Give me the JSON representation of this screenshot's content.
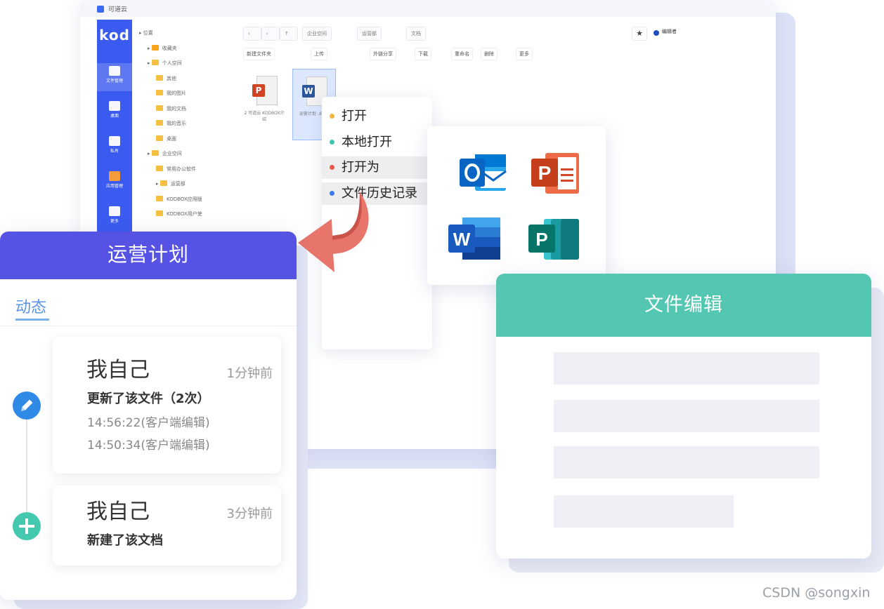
{
  "window": {
    "app_name": "可道云",
    "logo": "kod",
    "side_items": [
      "文件管理",
      "桌面",
      "私有",
      "应用管理",
      "更多"
    ],
    "tree": [
      {
        "label": "位置",
        "icon": "none",
        "indent": 0
      },
      {
        "label": "收藏夹",
        "icon": "star",
        "indent": 1
      },
      {
        "label": "个人空间",
        "icon": "folder",
        "indent": 1
      },
      {
        "label": "其他",
        "icon": "folder",
        "indent": 2
      },
      {
        "label": "我的图片",
        "icon": "folder",
        "indent": 2
      },
      {
        "label": "我的文档",
        "icon": "folder",
        "indent": 2
      },
      {
        "label": "我的音乐",
        "icon": "folder",
        "indent": 2
      },
      {
        "label": "桌面",
        "icon": "folder",
        "indent": 2
      },
      {
        "label": "企业空间",
        "icon": "folder",
        "indent": 1
      },
      {
        "label": "常用办公软件",
        "icon": "folder",
        "indent": 2
      },
      {
        "label": "运营部",
        "icon": "folder",
        "indent": 2
      },
      {
        "label": "KODBOX应用版",
        "icon": "folder",
        "indent": 2
      },
      {
        "label": "KODBOX用户使",
        "icon": "folder",
        "indent": 2
      }
    ],
    "breadcrumb": [
      "企业空间",
      "运营部",
      "文档"
    ],
    "user": "编辑者",
    "toolbar": [
      "新建文件夹",
      "上传",
      "外链分享",
      "下载",
      "重命名",
      "删除",
      "更多"
    ],
    "files": [
      {
        "name": "2 可道云 KODBOX介绍",
        "type": "ppt",
        "color": "#d04423",
        "selected": false
      },
      {
        "name": "运营计划 .docx",
        "type": "word",
        "color": "#2b579a",
        "selected": true
      }
    ]
  },
  "context_menu": [
    {
      "label": "打开",
      "dot": "#f2b53d",
      "highlight": false
    },
    {
      "label": "本地打开",
      "dot": "#3dc6b4",
      "highlight": false
    },
    {
      "label": "打开为",
      "dot": "#e8584a",
      "highlight": true
    },
    {
      "label": "文件历史记录",
      "dot": "#3a7bef",
      "highlight": true
    }
  ],
  "open_with": [
    {
      "name": "outlook-icon",
      "letter": "O",
      "color": "#0a64c4"
    },
    {
      "name": "powerpoint-icon",
      "letter": "P",
      "color": "#c9482b"
    },
    {
      "name": "word-icon",
      "letter": "W",
      "color": "#2b5aaa"
    },
    {
      "name": "publisher-icon",
      "letter": "P",
      "color": "#137a6e"
    }
  ],
  "activity": {
    "title": "运营计划",
    "tab": "动态",
    "entries": [
      {
        "who": "我自己",
        "when": "1分钟前",
        "action": "更新了该文件（2次）",
        "lines": [
          "14:56:22(客户端编辑)",
          "14:50:34(客户端编辑)"
        ],
        "icon": "pencil",
        "icon_color": "#2f8ae6"
      },
      {
        "who": "我自己",
        "when": "3分钟前",
        "action": "新建了该文档",
        "lines": [],
        "icon": "plus",
        "icon_color": "#44c9ae"
      }
    ]
  },
  "editor": {
    "title": "文件编辑"
  },
  "watermark": "CSDN @songxin"
}
